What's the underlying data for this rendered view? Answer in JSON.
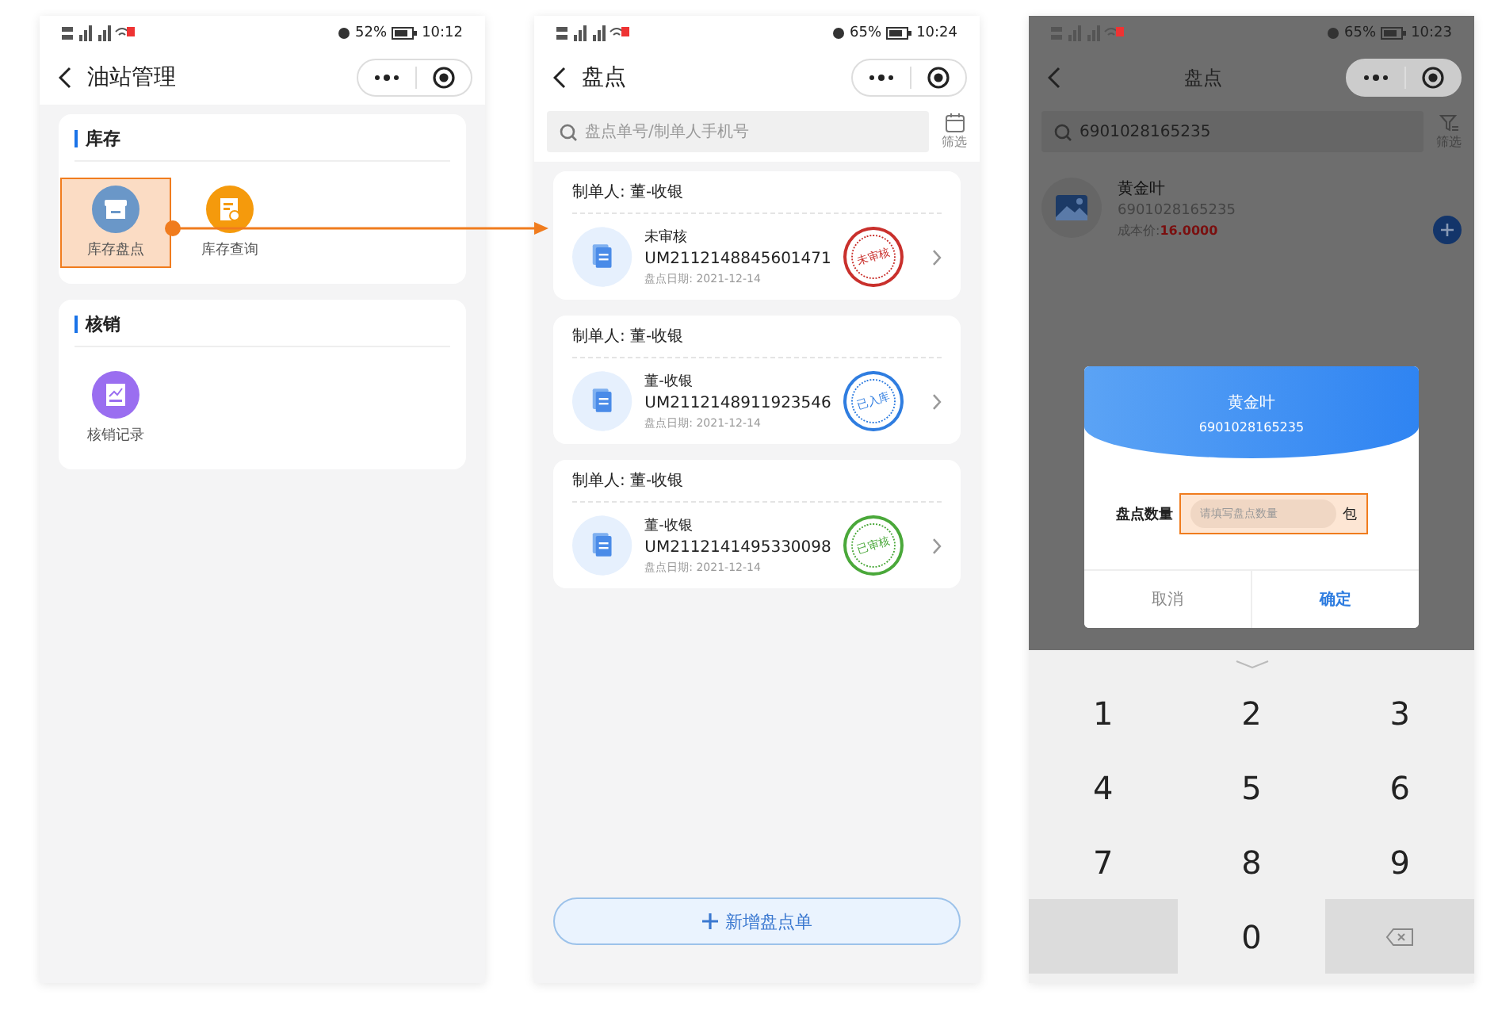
{
  "screens": [
    {
      "kind": "menu",
      "status": {
        "battery": "52%",
        "time": "10:12"
      },
      "title": "油站管理",
      "sections": [
        {
          "title": "库存",
          "items": [
            {
              "label": "库存盘点",
              "kind": "box",
              "color": "#6a97c8",
              "highlighted": true
            },
            {
              "label": "库存查询",
              "kind": "doc",
              "color": "#f59a0c",
              "highlighted": false
            }
          ]
        },
        {
          "title": "核销",
          "items": [
            {
              "label": "核销记录",
              "kind": "chart",
              "color": "#9a6ef0",
              "highlighted": false
            }
          ]
        }
      ]
    },
    {
      "kind": "list",
      "status": {
        "battery": "65%",
        "time": "10:24"
      },
      "title": "盘点",
      "search": {
        "placeholder": "盘点单号/制单人手机号"
      },
      "filter_label": "筛选",
      "orders": [
        {
          "maker": "制单人: 董-收银",
          "name": "未审核",
          "number": "UM2112148845601471",
          "date": "盘点日期: 2021-12-14",
          "stamp": "未审核",
          "color": "#c9302c"
        },
        {
          "maker": "制单人: 董-收银",
          "name": "董-收银",
          "number": "UM2112148911923546",
          "date": "盘点日期: 2021-12-14",
          "stamp": "已入库",
          "color": "#2f7de0"
        },
        {
          "maker": "制单人: 董-收银",
          "name": "董-收银",
          "number": "UM2112141495330098",
          "date": "盘点日期: 2021-12-14",
          "stamp": "已审核",
          "color": "#4aa83a"
        }
      ],
      "add_button": "新增盘点单"
    },
    {
      "kind": "dialog",
      "status": {
        "battery": "65%",
        "time": "10:23"
      },
      "title": "盘点",
      "search": {
        "value": "6901028165235"
      },
      "filter_label": "筛选",
      "product": {
        "name": "黄金叶",
        "code": "6901028165235",
        "price_label": "成本价:",
        "price": "16.0000"
      },
      "dialog": {
        "title": "黄金叶",
        "code": "6901028165235",
        "field_label": "盘点数量",
        "placeholder": "请填写盘点数量",
        "unit": "包",
        "highlighted": true,
        "cancel": "取消",
        "confirm": "确定"
      },
      "keys": [
        "1",
        "2",
        "3",
        "4",
        "5",
        "6",
        "7",
        "8",
        "9",
        "0"
      ]
    }
  ]
}
